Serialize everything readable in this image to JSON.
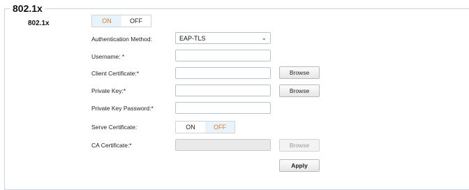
{
  "section": {
    "legend": "802.1x",
    "label": "802.1x",
    "toggle": {
      "on_label": "ON",
      "off_label": "OFF",
      "selected": "ON"
    }
  },
  "form": {
    "auth_method": {
      "label": "Authentication Method:",
      "value": "EAP-TLS"
    },
    "username": {
      "label": "Username: *",
      "value": ""
    },
    "client_certificate": {
      "label": "Client Certificate:*",
      "value": "",
      "button": "Browse"
    },
    "private_key": {
      "label": "Private Key:*",
      "value": "",
      "button": "Browse"
    },
    "private_key_password": {
      "label": "Private Key Password:*",
      "value": ""
    },
    "serve_certificate": {
      "label": "Serve Certificate:",
      "on_label": "ON",
      "off_label": "OFF",
      "selected": "OFF"
    },
    "ca_certificate": {
      "label": "CA Certificate:*",
      "value": "",
      "button": "Browse"
    },
    "apply_label": "Apply"
  },
  "colors": {
    "active_text": "#e07a2e",
    "active_bg": "#e9f3fc",
    "border": "#c9d6e3"
  },
  "icons": {
    "dropdown": "chevron-down-icon"
  }
}
